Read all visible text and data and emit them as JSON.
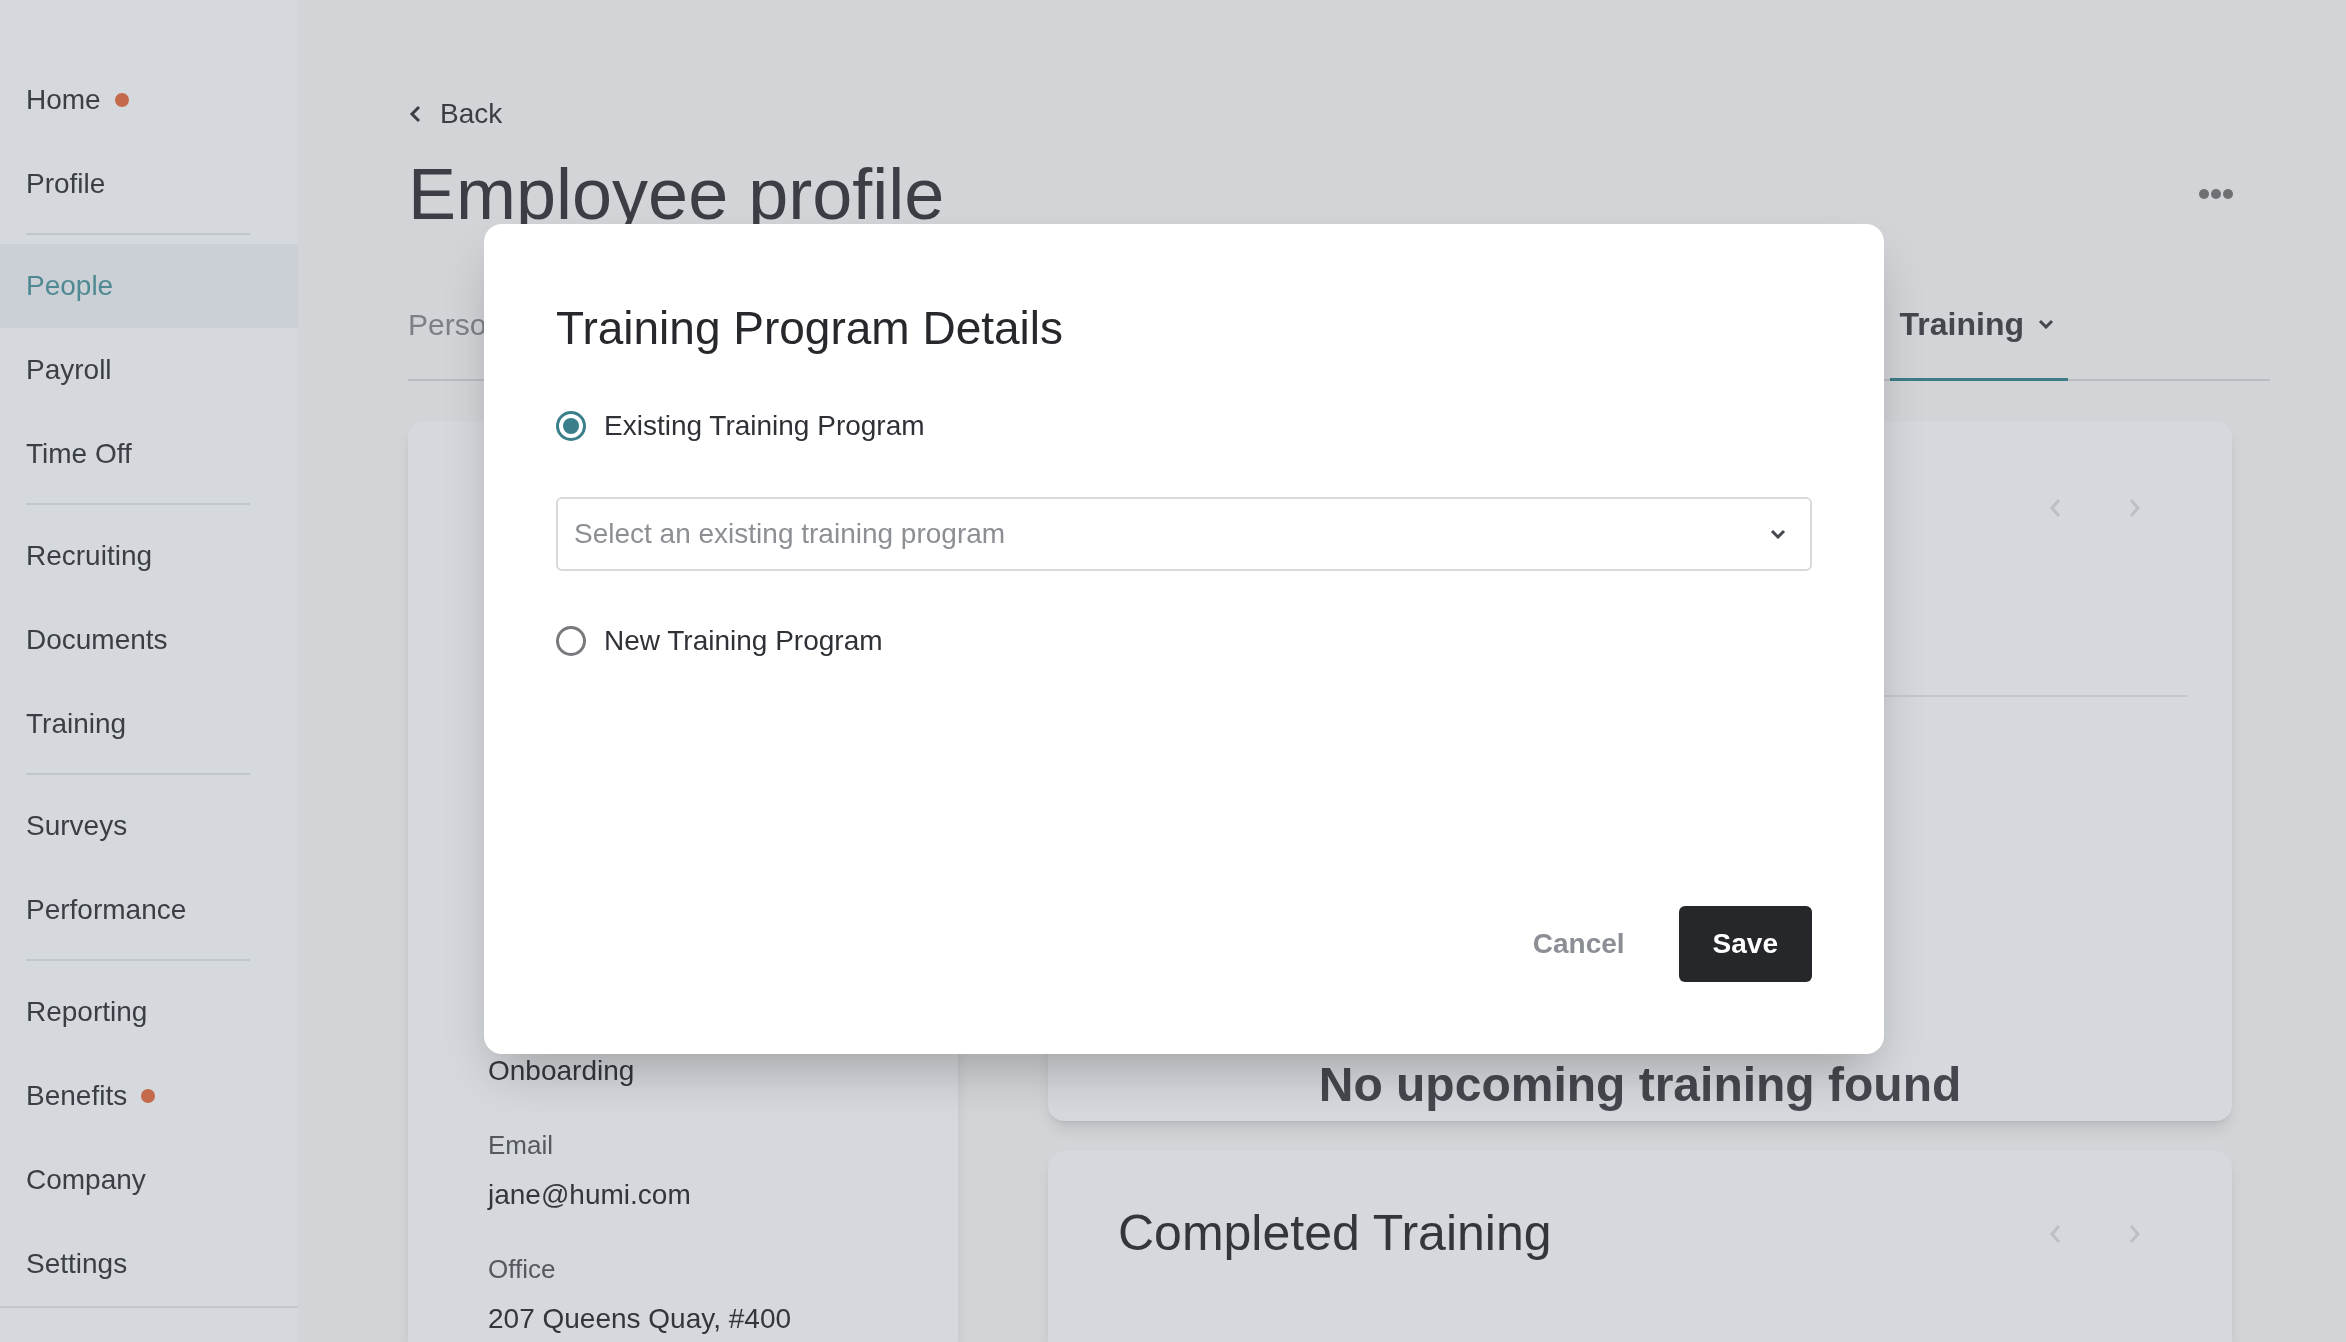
{
  "sidebar": {
    "groups": [
      {
        "items": [
          {
            "label": "Home",
            "selected": false,
            "badge": true
          },
          {
            "label": "Profile",
            "selected": false,
            "badge": false
          }
        ]
      },
      {
        "items": [
          {
            "label": "People",
            "selected": true,
            "badge": false
          },
          {
            "label": "Payroll",
            "selected": false,
            "badge": false
          },
          {
            "label": "Time Off",
            "selected": false,
            "badge": false
          }
        ]
      },
      {
        "items": [
          {
            "label": "Recruiting",
            "selected": false,
            "badge": false
          },
          {
            "label": "Documents",
            "selected": false,
            "badge": false
          },
          {
            "label": "Training",
            "selected": false,
            "badge": false
          }
        ]
      },
      {
        "items": [
          {
            "label": "Surveys",
            "selected": false,
            "badge": false
          },
          {
            "label": "Performance",
            "selected": false,
            "badge": false
          }
        ]
      },
      {
        "items": [
          {
            "label": "Reporting",
            "selected": false,
            "badge": false
          },
          {
            "label": "Benefits",
            "selected": false,
            "badge": true
          },
          {
            "label": "Company",
            "selected": false,
            "badge": false
          },
          {
            "label": "Settings",
            "selected": false,
            "badge": false
          }
        ]
      }
    ]
  },
  "page": {
    "back": "Back",
    "title": "Employee profile",
    "tabs": [
      {
        "label": "Perso",
        "selected": false
      },
      {
        "label": "Training",
        "selected": true,
        "caret": true
      }
    ]
  },
  "details_card": {
    "fields": [
      {
        "kind": "value",
        "text": "Onboarding"
      },
      {
        "kind": "label",
        "text": "Email"
      },
      {
        "kind": "value",
        "text": "jane@humi.com"
      },
      {
        "kind": "label",
        "text": "Office"
      },
      {
        "kind": "value",
        "text": "207 Queens Quay, #400"
      }
    ]
  },
  "upcoming_card": {
    "empty_message": "No upcoming training found"
  },
  "completed_card": {
    "title": "Completed Training"
  },
  "dialog": {
    "title": "Training Program Details",
    "options": [
      {
        "label": "Existing Training Program",
        "selected": true
      },
      {
        "label": "New Training Program",
        "selected": false
      }
    ],
    "select": {
      "placeholder": "Select an existing training program"
    },
    "buttons": [
      {
        "label": "Cancel",
        "kind": "secondary"
      },
      {
        "label": "Save",
        "kind": "primary"
      }
    ]
  }
}
